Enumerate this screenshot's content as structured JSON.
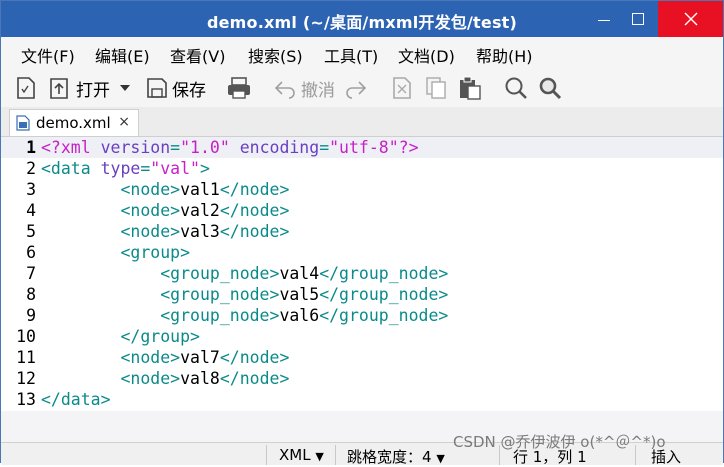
{
  "window": {
    "title": "demo.xml (~/桌面/mxml开发包/test)",
    "accent": "#2d63b3"
  },
  "menu": [
    "文件(F)",
    "编辑(E)",
    "查看(V)",
    "搜索(S)",
    "工具(T)",
    "文档(D)",
    "帮助(H)"
  ],
  "toolbar": {
    "new_icon": "new-document-icon",
    "open_label": "打开",
    "save_label": "保存",
    "print_icon": "printer-icon",
    "undo_label": "撤消",
    "redo_icon": "redo-icon",
    "cut_icon": "cut-icon",
    "copy_icon": "copy-icon",
    "paste_icon": "paste-icon",
    "search_icon": "search-icon",
    "search_replace_icon": "search-replace-icon"
  },
  "tab": {
    "label": "demo.xml",
    "close": "×"
  },
  "editor": {
    "lines": [
      "1",
      "2",
      "3",
      "4",
      "5",
      "6",
      "7",
      "8",
      "9",
      "10",
      "11",
      "12",
      "13"
    ],
    "current_line": 1
  },
  "status": {
    "language": "XML",
    "tab_width_label": "跳格宽度：",
    "tab_width_value": "4",
    "position": "行 1，列 1",
    "mode": "插入"
  },
  "watermark": "CSDN @乔伊波伊 o(*^＠^*)o"
}
